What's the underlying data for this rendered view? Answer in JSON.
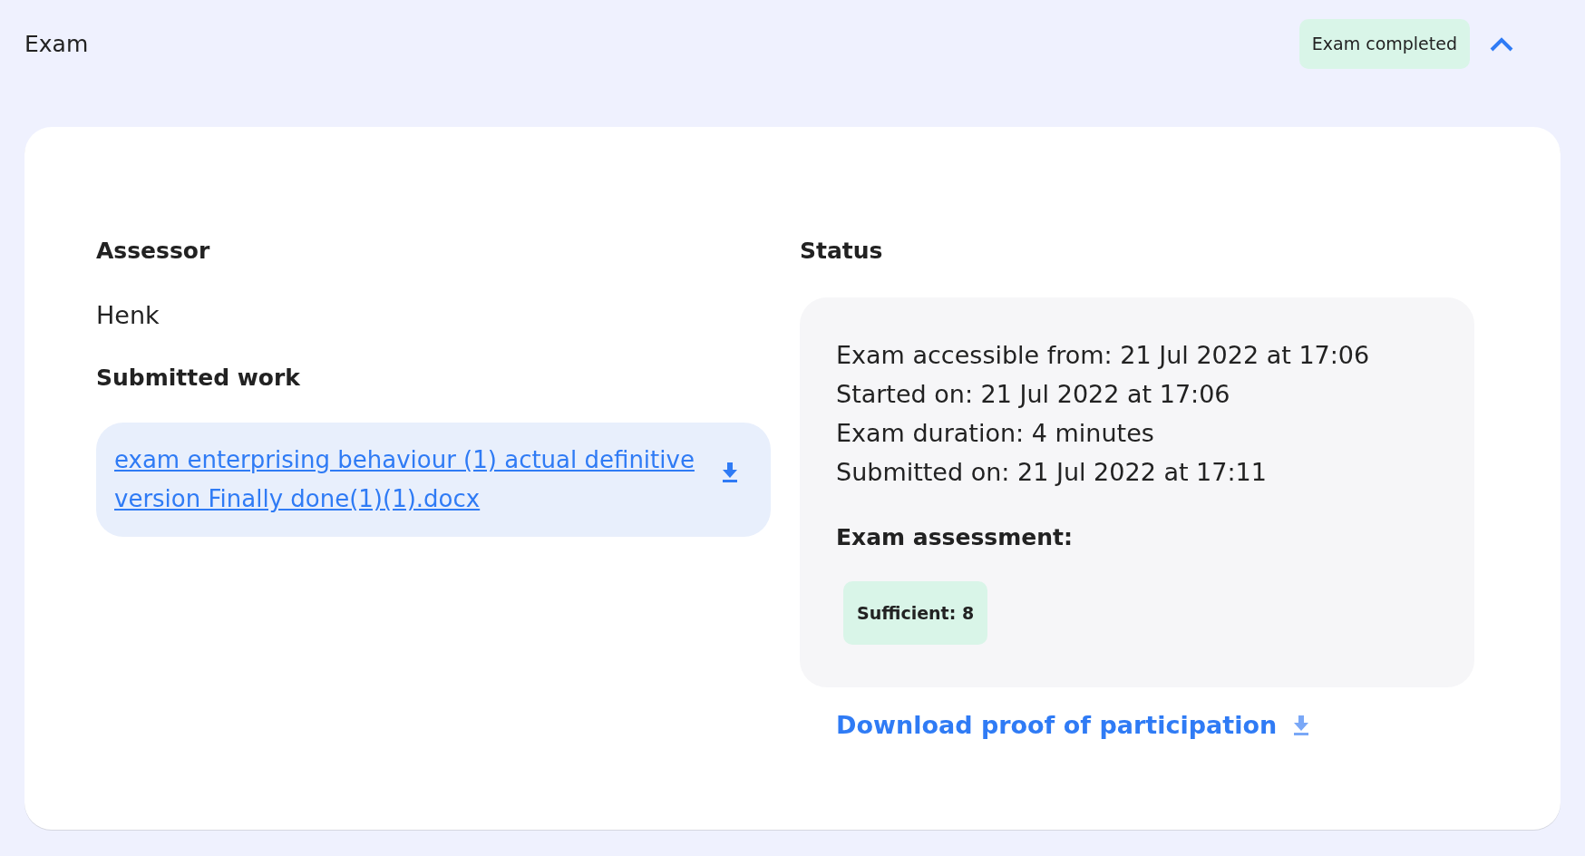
{
  "section": {
    "title": "Exam",
    "badge": "Exam completed",
    "expanded": true
  },
  "assessor": {
    "heading": "Assessor",
    "name": "Henk"
  },
  "submitted_work": {
    "heading": "Submitted work",
    "file": "exam enterprising behaviour (1) actual definitive version Finally done(1)(1).docx"
  },
  "status": {
    "heading": "Status",
    "lines": [
      "Exam accessible from: 21 Jul 2022 at 17:06",
      "Started on: 21 Jul 2022 at 17:06",
      "Exam duration: 4 minutes",
      "Submitted on: 21 Jul 2022 at 17:11"
    ],
    "assessment_heading": "Exam assessment:",
    "assessment": "Sufficient: 8"
  },
  "download_link": "Download proof of participation"
}
